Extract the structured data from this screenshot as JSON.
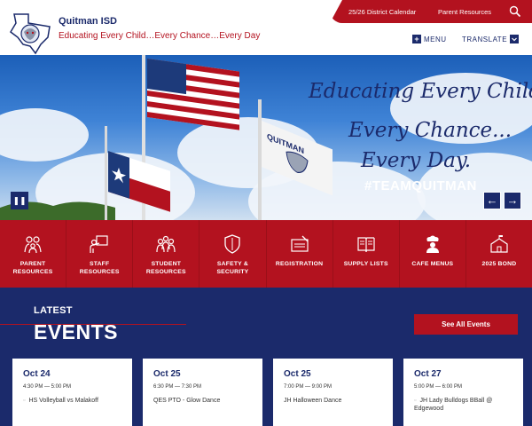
{
  "header": {
    "site_name": "Quitman ISD",
    "tagline": "Educating Every Child…Every Chance…Every Day",
    "topbar": {
      "calendar_link": "25/26 District Calendar",
      "parent_link": "Parent Resources",
      "search_icon": "search-icon"
    },
    "menu_label": "MENU",
    "translate_label": "TRANSLATE"
  },
  "hero": {
    "script_line1": "Educating Every Child...",
    "script_line2": "Every Chance...",
    "script_line3": "Every Day.",
    "hashtag": "#TEAMQUITMAN",
    "pause_symbol": "❚❚",
    "prev_symbol": "←",
    "next_symbol": "→"
  },
  "quick_links": [
    {
      "label": "PARENT RESOURCES",
      "icon": "family-icon"
    },
    {
      "label": "STAFF RESOURCES",
      "icon": "teacher-icon"
    },
    {
      "label": "STUDENT RESOURCES",
      "icon": "students-icon"
    },
    {
      "label": "SAFETY & SECURITY",
      "icon": "shield-icon"
    },
    {
      "label": "REGISTRATION",
      "icon": "clipboard-icon"
    },
    {
      "label": "SUPPLY LISTS",
      "icon": "book-icon"
    },
    {
      "label": "CAFE MENUS",
      "icon": "chef-icon"
    },
    {
      "label": "2025 BOND",
      "icon": "school-building-icon"
    }
  ],
  "events": {
    "heading_small": "LATEST",
    "heading_big": "EVENTS",
    "see_all": "See All Events",
    "items": [
      {
        "date": "Oct 24",
        "time": "4:30 PM — 5:00 PM",
        "title": "HS Volleyball vs Malakoff"
      },
      {
        "date": "Oct 25",
        "time": "6:30 PM — 7:30 PM",
        "title": "QES PTO - Glow Dance"
      },
      {
        "date": "Oct 25",
        "time": "7:00 PM — 9:00 PM",
        "title": "JH Halloween Dance"
      },
      {
        "date": "Oct 27",
        "time": "5:00 PM — 6:00 PM",
        "title": "JH Lady Bulldogs BBall @ Edgewood"
      }
    ]
  },
  "colors": {
    "navy": "#1b2a6b",
    "red": "#b3121f"
  }
}
